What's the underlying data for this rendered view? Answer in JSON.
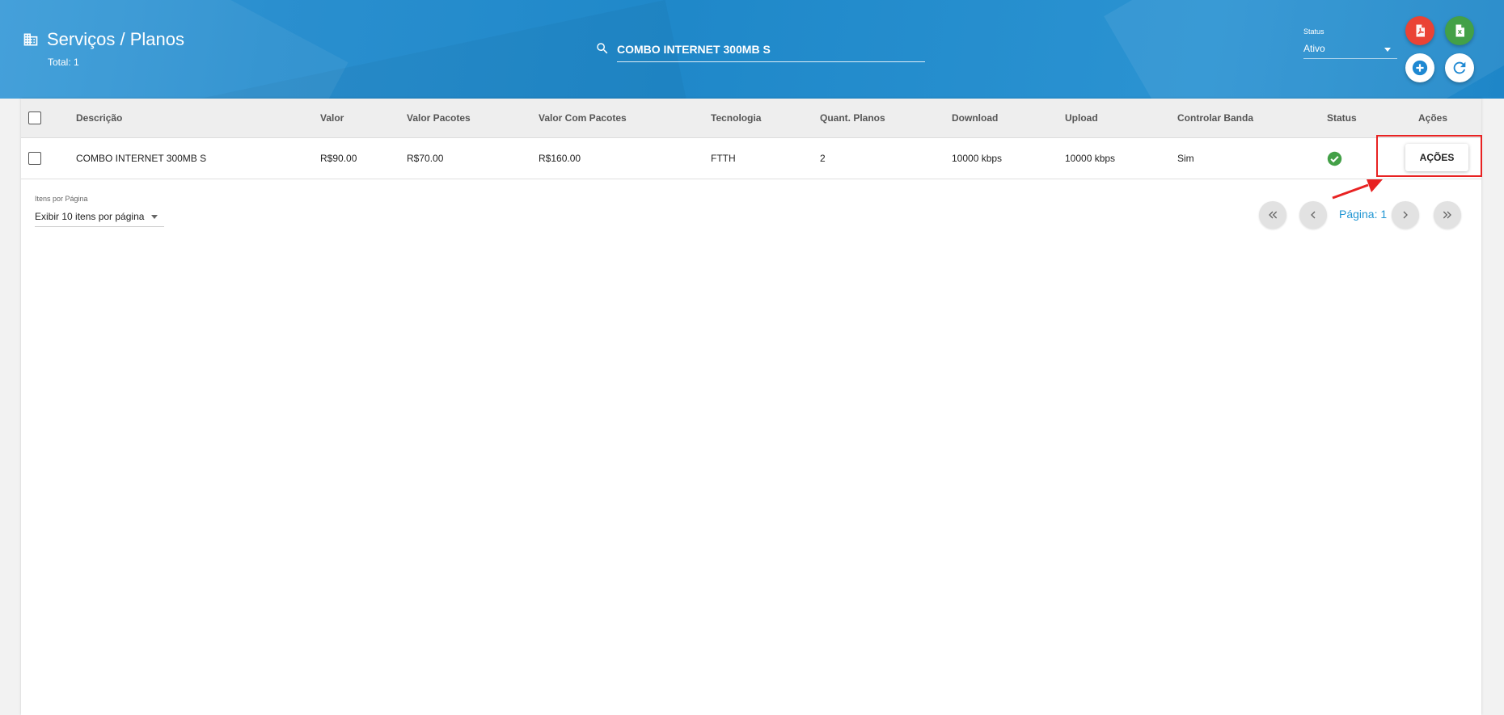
{
  "header": {
    "title": "Serviços / Planos",
    "total": "Total: 1",
    "search": {
      "value": "COMBO INTERNET 300MB S"
    },
    "status_filter": {
      "label": "Status",
      "selected": "Ativo"
    },
    "colors": {
      "pdf": "#ea4335",
      "excel": "#43a047",
      "brand": "#2a8fcf"
    }
  },
  "table": {
    "columns": [
      "Descrição",
      "Valor",
      "Valor Pacotes",
      "Valor Com Pacotes",
      "Tecnologia",
      "Quant. Planos",
      "Download",
      "Upload",
      "Controlar Banda",
      "Status",
      "Ações"
    ],
    "rows": [
      {
        "descricao": "COMBO INTERNET 300MB S",
        "valor": "R$90.00",
        "valor_pacotes": "R$70.00",
        "valor_com_pacotes": "R$160.00",
        "tecnologia": "FTTH",
        "quant_planos": "2",
        "download": "10000 kbps",
        "upload": "10000 kbps",
        "controlar_banda": "Sim",
        "status_icon": "check-circle-icon",
        "acoes_label": "AÇÕES"
      }
    ]
  },
  "footer": {
    "items_label": "Itens por Página",
    "items_selected": "Exibir 10 itens por página",
    "page_label": "Página: 1"
  }
}
